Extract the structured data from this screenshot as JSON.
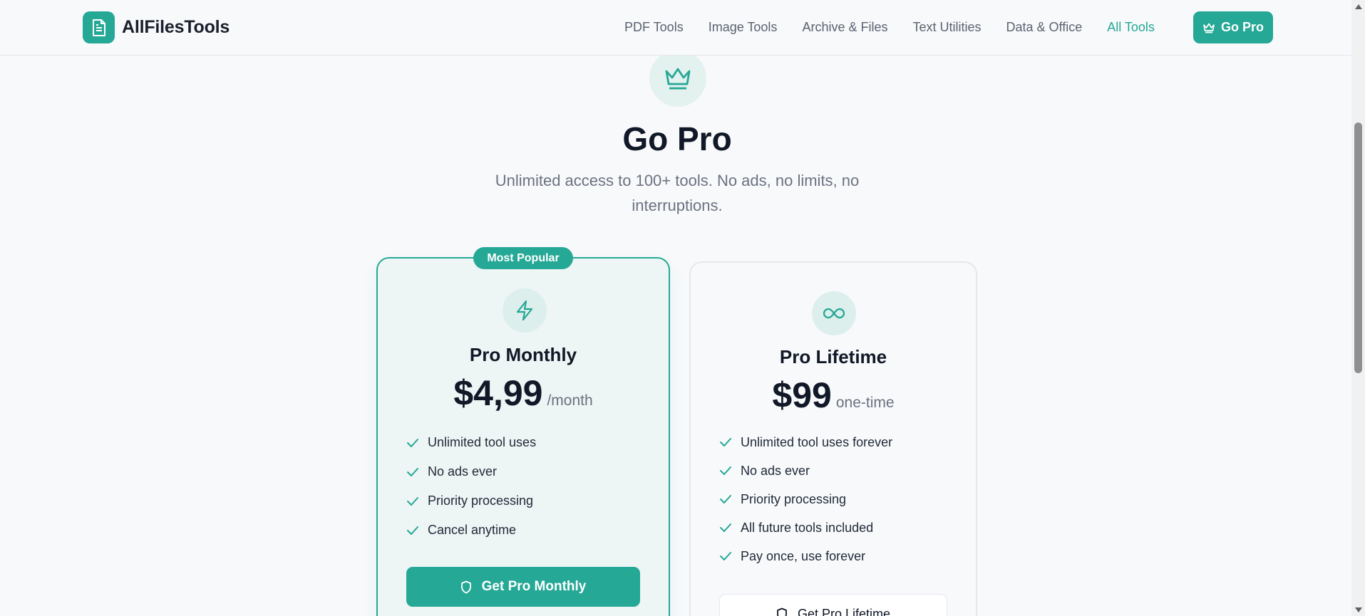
{
  "header": {
    "brand": "AllFilesTools",
    "nav": [
      {
        "label": "PDF Tools"
      },
      {
        "label": "Image Tools"
      },
      {
        "label": "Archive & Files"
      },
      {
        "label": "Text Utilities"
      },
      {
        "label": "Data & Office"
      },
      {
        "label": "All Tools",
        "active": true
      }
    ],
    "cta_label": "Go Pro"
  },
  "hero": {
    "icon": "crown-icon",
    "title": "Go Pro",
    "subtitle": "Unlimited access to 100+ tools. No ads, no limits, no interruptions."
  },
  "plans": [
    {
      "badge": "Most Popular",
      "icon": "lightning-icon",
      "name": "Pro Monthly",
      "price": "$4,99",
      "period": "/month",
      "features": [
        "Unlimited tool uses",
        "No ads ever",
        "Priority processing",
        "Cancel anytime"
      ],
      "cta": "Get Pro Monthly"
    },
    {
      "icon": "infinity-icon",
      "name": "Pro Lifetime",
      "price": "$99",
      "period": "one-time",
      "features": [
        "Unlimited tool uses forever",
        "No ads ever",
        "Priority processing",
        "All future tools included",
        "Pay once, use forever"
      ],
      "cta": "Get Pro Lifetime"
    }
  ],
  "colors": {
    "accent": "#25a896",
    "background": "#f8f9fb",
    "text": "#111827",
    "muted": "#6b7280"
  }
}
